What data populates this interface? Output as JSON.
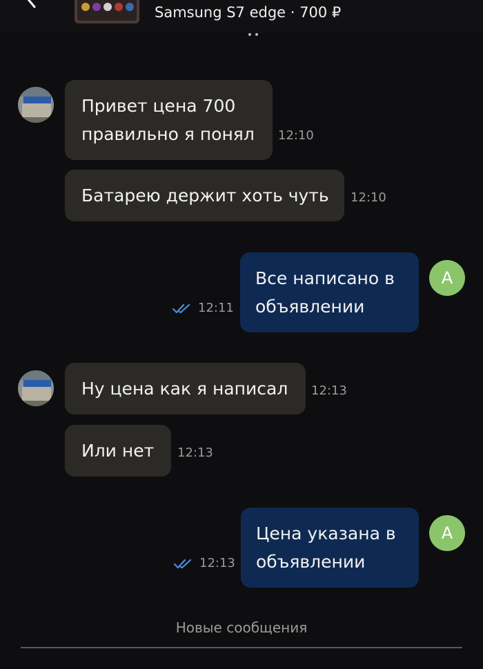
{
  "header": {
    "ad_title": "Samsung S7 edge · 700 ₽",
    "back_icon": "chevron-left-icon"
  },
  "messages": [
    {
      "direction": "incoming",
      "lines": [
        "Привет цена 700",
        "правильно я понял"
      ],
      "time": "12:10"
    },
    {
      "direction": "incoming",
      "lines": [
        "Батарею держит хоть чуть"
      ],
      "time": "12:10"
    },
    {
      "direction": "outgoing",
      "lines": [
        "Все написано в",
        "объявлении"
      ],
      "time": "12:11",
      "status_icon": "double-check-icon"
    },
    {
      "direction": "incoming",
      "lines": [
        "Ну цена как я написал"
      ],
      "time": "12:13"
    },
    {
      "direction": "incoming",
      "lines": [
        "Или нет"
      ],
      "time": "12:13"
    },
    {
      "direction": "outgoing",
      "lines": [
        "Цена указана в",
        "объявлении"
      ],
      "time": "12:13",
      "status_icon": "double-check-icon"
    }
  ],
  "user_avatar_letter": "A",
  "footer": {
    "new_messages_label": "Новые сообщения"
  },
  "colors": {
    "background": "#0e0e10",
    "incoming_bubble": "#2c2a27",
    "outgoing_bubble": "#0f2a52",
    "avatar_green": "#8bc56b",
    "read_check": "#4a90e2",
    "timestamp": "#9a9a9a"
  }
}
